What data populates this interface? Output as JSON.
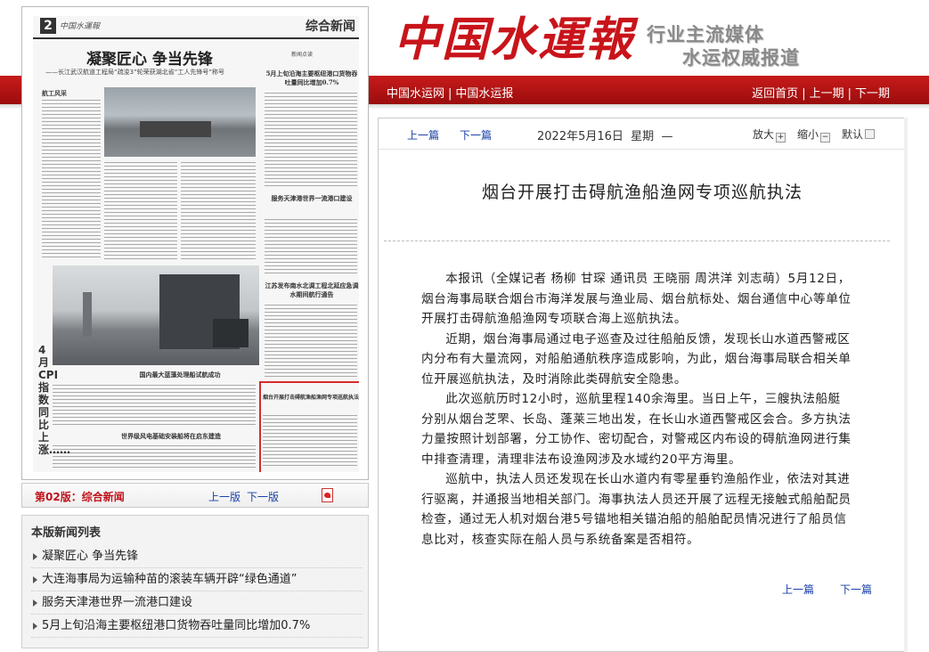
{
  "header": {
    "logo_text": "中国水運報",
    "slogan_line1": "行业主流媒体",
    "slogan_line2": "水运权威报道",
    "nav_left": [
      "中国水运网",
      "中国水运报"
    ],
    "nav_right": [
      "返回首页",
      "上一期",
      "下一期"
    ],
    "separator": "|"
  },
  "newspaper": {
    "page_number": "2",
    "brand": "中国水運報",
    "section": "综合新闻",
    "headline": "凝聚匠心 争当先锋",
    "subhead": "——长江武汉航道工程局“疏浚3”轮荣获湖北省“工人先锋号”称号",
    "column_label": "航工风采",
    "small_tag": "新闻点读",
    "col_titles": [
      "5月上旬沿海主要枢纽港口货物吞吐量同比增加0.7%",
      "服务天津港世界一流港口建设",
      "江苏发布南水北调工程北延应急调水期间航行通告",
      "国内最大蓝藻处理船试航成功",
      "世界级风电基础安装船将在启东建造",
      "烟台开展打击碍航渔船渔网专项巡航执法"
    ],
    "vertical_head": "4月CPI指数同比上涨……"
  },
  "page_nav": {
    "current": "第02版：综合新闻",
    "prev": "上一版",
    "next": "下一版",
    "pdf_icon": "pdf-icon"
  },
  "news_list": {
    "title": "本版新闻列表",
    "items": [
      "凝聚匠心 争当先锋",
      "大连海事局为运输种苗的滚装车辆开辟“绿色通道”",
      "服务天津港世界一流港口建设",
      "5月上旬沿海主要枢纽港口货物吞吐量同比增加0.7%"
    ]
  },
  "article": {
    "toolbar": {
      "prev": "上一篇",
      "next": "下一篇",
      "date": "2022年5月16日",
      "weekday": "星期",
      "dash": "—",
      "zoom_in": "放大",
      "zoom_out": "缩小",
      "default": "默认"
    },
    "title": "烟台开展打击碍航渔船渔网专项巡航执法",
    "paragraphs": [
      "本报讯（全媒记者 杨柳 甘琛 通讯员 王晓丽 周洪洋 刘志萌）5月12日，烟台海事局联合烟台市海洋发展与渔业局、烟台航标处、烟台通信中心等单位开展打击碍航渔船渔网专项联合海上巡航执法。",
      "近期，烟台海事局通过电子巡查及过往船舶反馈，发现长山水道西警戒区内分布有大量流网，对船舶通航秩序造成影响，为此，烟台海事局联合相关单位开展巡航执法，及时消除此类碍航安全隐患。",
      "此次巡航历时12小时，巡航里程140余海里。当日上午，三艘执法船艇分别从烟台芝罘、长岛、蓬莱三地出发，在长山水道西警戒区会合。多方执法力量按照计划部署，分工协作、密切配合，对警戒区内布设的碍航渔网进行集中排查清理，清理非法布设渔网涉及水域约20平方海里。",
      "巡航中，执法人员还发现在长山水道内有零星垂钓渔船作业，依法对其进行驱离，并通报当地相关部门。海事执法人员还开展了远程无接触式船舶配员检查，通过无人机对烟台港5号锚地相关锚泊船的船舶配员情况进行了船员信息比对，核查实际在船人员与系统备案是否相符。"
    ],
    "bottom_prev": "上一篇",
    "bottom_next": "下一篇"
  },
  "colors": {
    "brand_red": "#c8141a",
    "link_blue": "#1a3fa8",
    "highlight_border": "#d62b2b"
  }
}
